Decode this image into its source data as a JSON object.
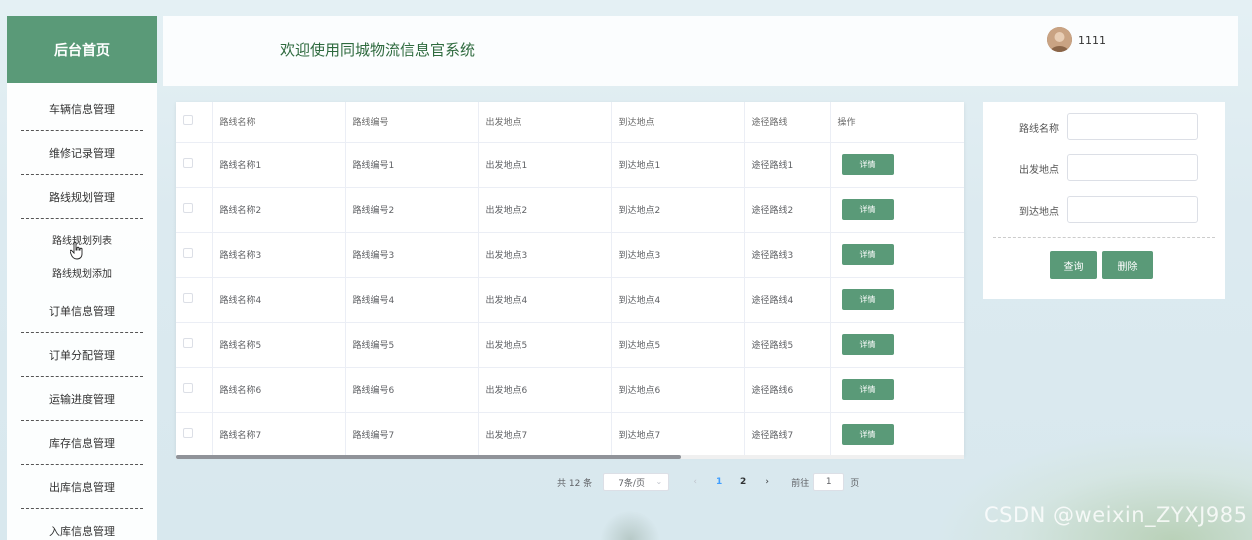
{
  "sidebar": {
    "title": "后台首页",
    "items": [
      {
        "label": "车辆信息管理"
      },
      {
        "label": "维修记录管理"
      },
      {
        "label": "路线规划管理"
      },
      {
        "label": "订单信息管理"
      },
      {
        "label": "订单分配管理"
      },
      {
        "label": "运输进度管理"
      },
      {
        "label": "库存信息管理"
      },
      {
        "label": "出库信息管理"
      },
      {
        "label": "入库信息管理"
      }
    ],
    "subitems": [
      {
        "label": "路线规划列表"
      },
      {
        "label": "路线规划添加"
      }
    ]
  },
  "header": {
    "welcome": "欢迎使用同城物流信息官系统",
    "username": "1111"
  },
  "table": {
    "columns": [
      "路线名称",
      "路线编号",
      "出发地点",
      "到达地点",
      "途径路线",
      "操作"
    ],
    "detail_label": "详情",
    "rows": [
      [
        "路线名称1",
        "路线编号1",
        "出发地点1",
        "到达地点1",
        "途径路线1"
      ],
      [
        "路线名称2",
        "路线编号2",
        "出发地点2",
        "到达地点2",
        "途径路线2"
      ],
      [
        "路线名称3",
        "路线编号3",
        "出发地点3",
        "到达地点3",
        "途径路线3"
      ],
      [
        "路线名称4",
        "路线编号4",
        "出发地点4",
        "到达地点4",
        "途径路线4"
      ],
      [
        "路线名称5",
        "路线编号5",
        "出发地点5",
        "到达地点5",
        "途径路线5"
      ],
      [
        "路线名称6",
        "路线编号6",
        "出发地点6",
        "到达地点6",
        "途径路线6"
      ],
      [
        "路线名称7",
        "路线编号7",
        "出发地点7",
        "到达地点7",
        "途径路线7"
      ]
    ]
  },
  "pagination": {
    "total": "共 12 条",
    "page_size": "7条/页",
    "prev": "‹",
    "next": "›",
    "pages": [
      "1",
      "2"
    ],
    "goto_label": "前往",
    "goto_value": "1",
    "goto_unit": "页"
  },
  "search": {
    "fields": [
      {
        "label": "路线名称",
        "value": ""
      },
      {
        "label": "出发地点",
        "value": ""
      },
      {
        "label": "到达地点",
        "value": ""
      }
    ],
    "query_label": "查询",
    "delete_label": "删除"
  },
  "watermark": "CSDN @weixin_ZYXJ985",
  "colors": {
    "accent": "#5a9a78",
    "active_page": "#409eff",
    "header_text": "#2e6a3e"
  }
}
